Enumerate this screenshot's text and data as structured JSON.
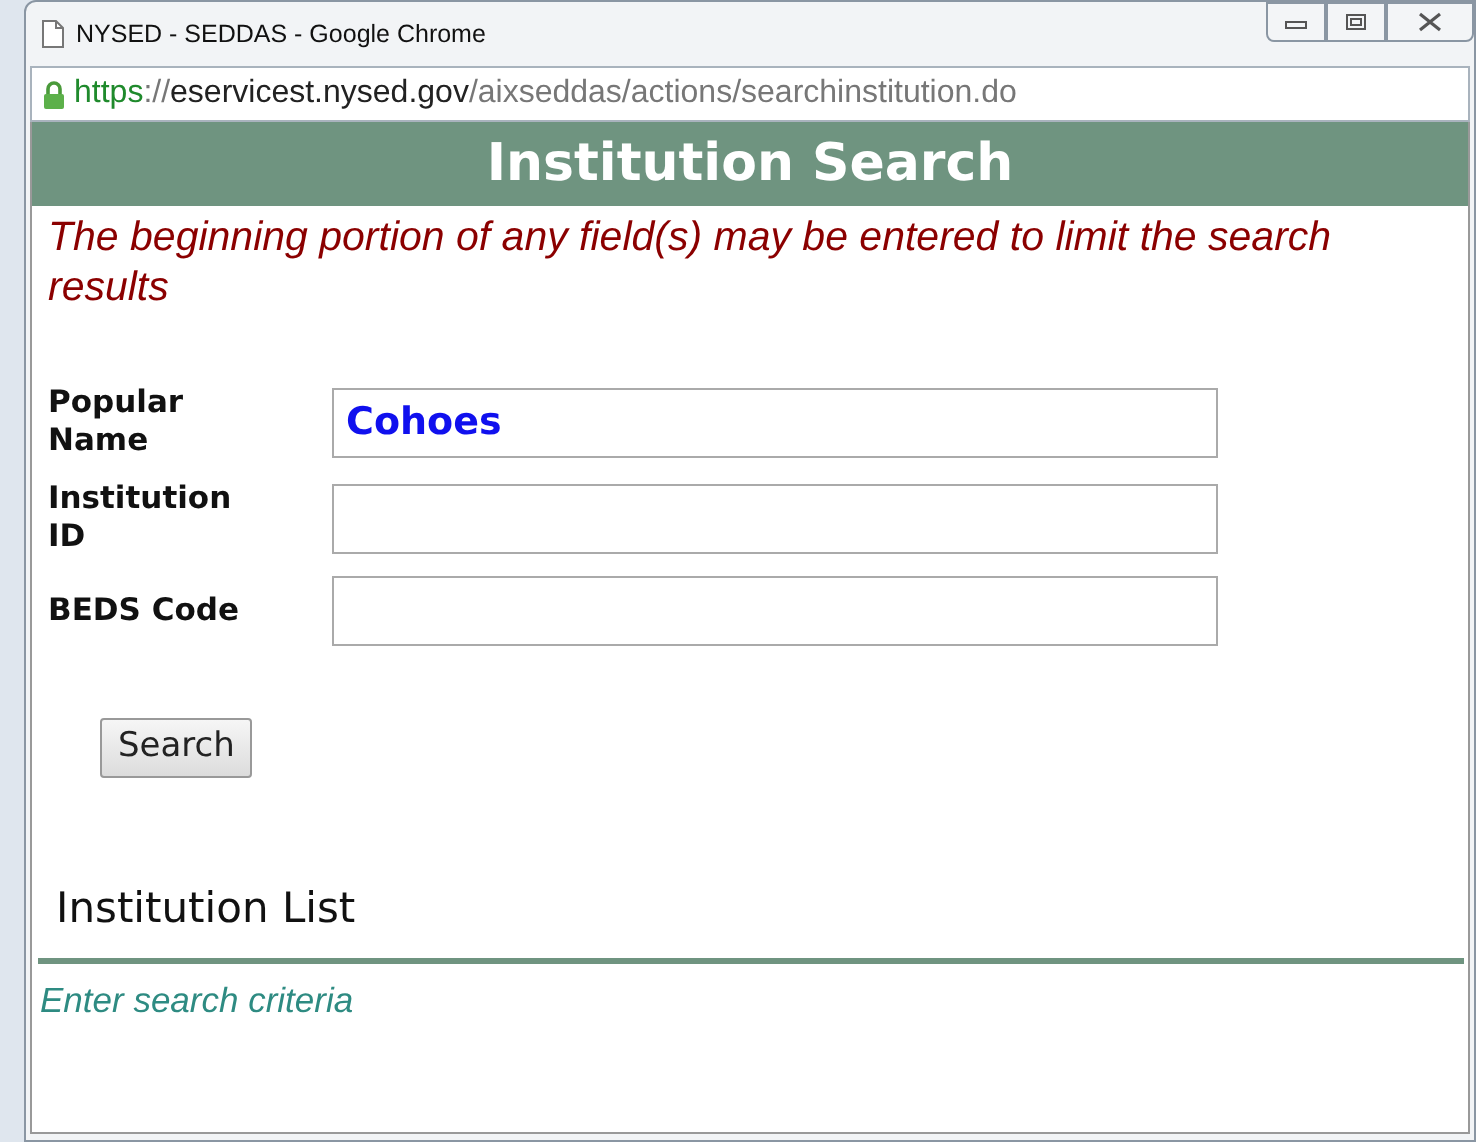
{
  "window": {
    "title": "NYSED - SEDDAS - Google Chrome"
  },
  "address_bar": {
    "secure": true,
    "scheme": "https",
    "separator": "://",
    "host": "eservicest.nysed.gov",
    "path": "/aixseddas/actions/searchinstitution.do"
  },
  "header": {
    "title": "Institution Search"
  },
  "instructions": "The beginning portion of any field(s) may be entered to limit the search results",
  "fields": [
    {
      "label": "Popular Name",
      "value": "Cohoes"
    },
    {
      "label": "Institution ID"
    },
    {
      "label": "BEDS Code"
    }
  ],
  "search_button": "Search",
  "results": {
    "heading": "Institution List",
    "message": "Enter search criteria"
  }
}
